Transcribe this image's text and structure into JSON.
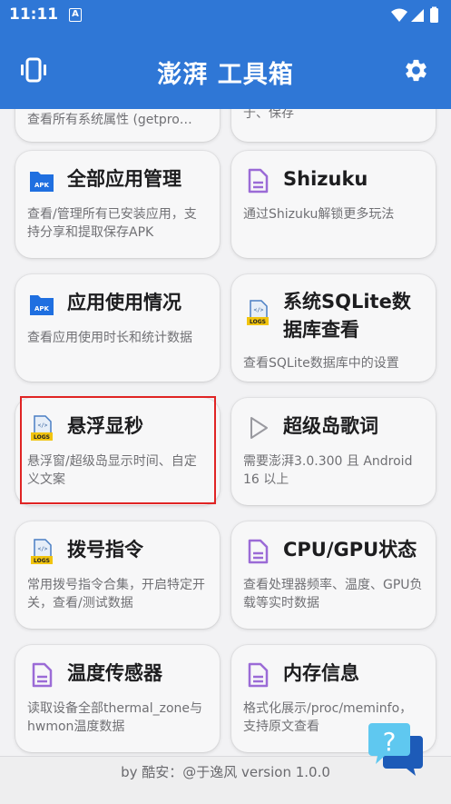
{
  "status": {
    "time": "11:11",
    "notif_letter": "A"
  },
  "app": {
    "title": "澎湃 工具箱"
  },
  "cards": {
    "partial_left_desc": "查看所有系统属性 (getpro…",
    "partial_right_desc": "于、保存",
    "all_apps": {
      "title": "全部应用管理",
      "desc": "查看/管理所有已安装应用，支持分享和提取保存APK",
      "icon_label": "APK"
    },
    "shizuku": {
      "title": "Shizuku",
      "desc": "通过Shizuku解锁更多玩法"
    },
    "app_usage": {
      "title": "应用使用情况",
      "desc": "查看应用使用时长和统计数据",
      "icon_label": "APK"
    },
    "sqlite": {
      "title": "系统SQLite数据库查看",
      "desc": "查看SQLite数据库中的设置",
      "icon_label": "LOGS"
    },
    "float_seconds": {
      "title": "悬浮显秒",
      "desc": "悬浮窗/超级岛显示时间、自定义文案",
      "icon_label": "LOGS"
    },
    "super_island_lyrics": {
      "title": "超级岛歌词",
      "desc": "需要澎湃3.0.300 且 Android 16 以上"
    },
    "dial_codes": {
      "title": "拨号指令",
      "desc": "常用拨号指令合集，开启特定开关，查看/测试数据",
      "icon_label": "LOGS"
    },
    "cpu_gpu": {
      "title": "CPU/GPU状态",
      "desc": "查看处理器频率、温度、GPU负载等实时数据"
    },
    "temp_sensor": {
      "title": "温度传感器",
      "desc": "读取设备全部thermal_zone与hwmon温度数据"
    },
    "memory": {
      "title": "内存信息",
      "desc": "格式化展示/proc/meminfo，支持原文查看"
    }
  },
  "footer": {
    "text": "by 酷安：@于逸风 version 1.0.0"
  },
  "help": {
    "symbol": "?"
  },
  "colors": {
    "primary": "#2f77d6",
    "highlight": "#e02424",
    "apk_blue": "#1f6fe0",
    "doc_purple": "#9b6bd6",
    "logs_yellow": "#f1c40f"
  }
}
